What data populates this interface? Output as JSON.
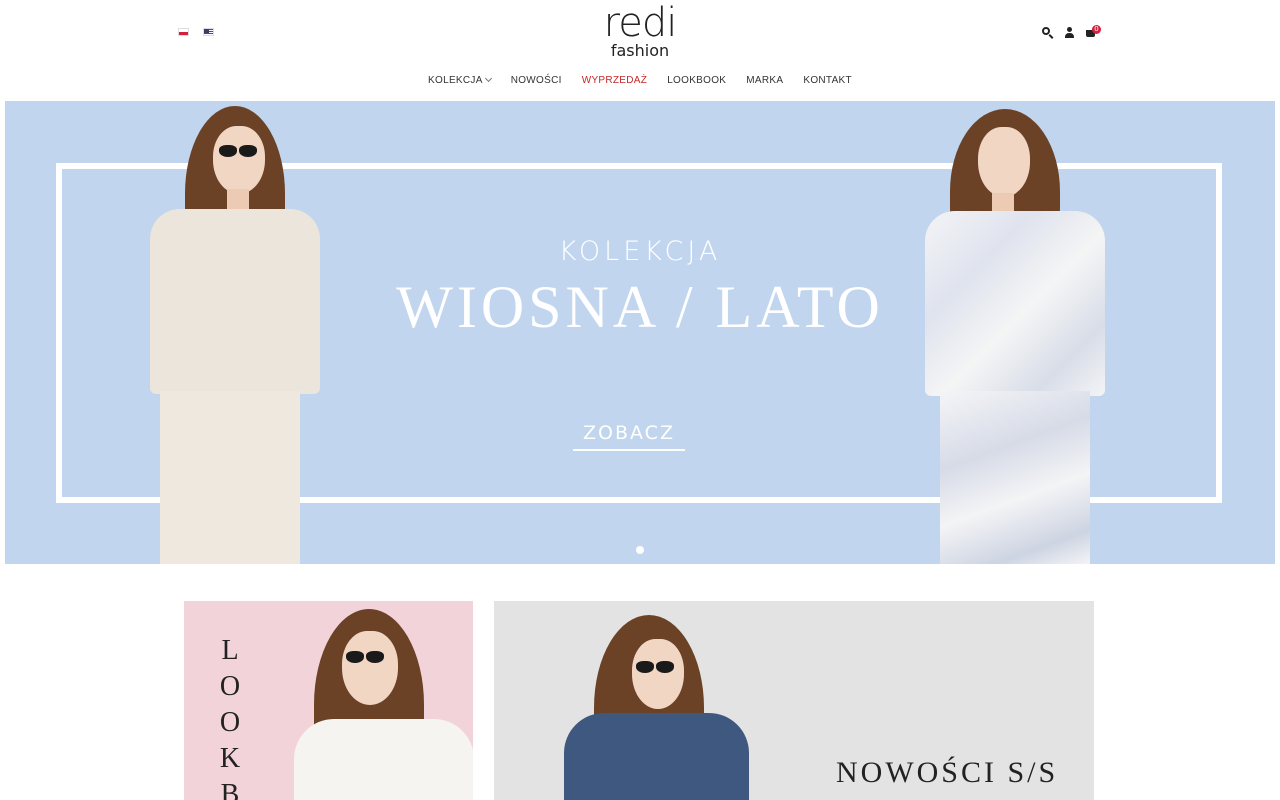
{
  "header": {
    "logo_top": "redi",
    "logo_bottom": "fashion",
    "languages": [
      "PL",
      "EN"
    ],
    "cart_count": "0",
    "icons": [
      "search-icon",
      "user-icon",
      "cart-icon"
    ]
  },
  "nav": {
    "items": [
      {
        "label": "KOLEKCJA",
        "has_dropdown": true
      },
      {
        "label": "NOWOŚCI"
      },
      {
        "label": "WYPRZEDAŻ"
      },
      {
        "label": "LOOKBOOK"
      },
      {
        "label": "MARKA"
      },
      {
        "label": "KONTAKT"
      }
    ]
  },
  "hero": {
    "subtitle": "KOLEKCJA",
    "title": "WIOSNA / LATO",
    "cta": "ZOBACZ",
    "background_color": "#c1d6ee"
  },
  "tiles": {
    "lookbook_letters": [
      "L",
      "O",
      "O",
      "K",
      "B"
    ],
    "right_title": "NOWOŚCI S/S",
    "left_background": "#f2d3d9",
    "right_background": "#e3e3e3"
  },
  "colors": {
    "sale_accent": "#c62828",
    "badge": "#d4213d"
  }
}
